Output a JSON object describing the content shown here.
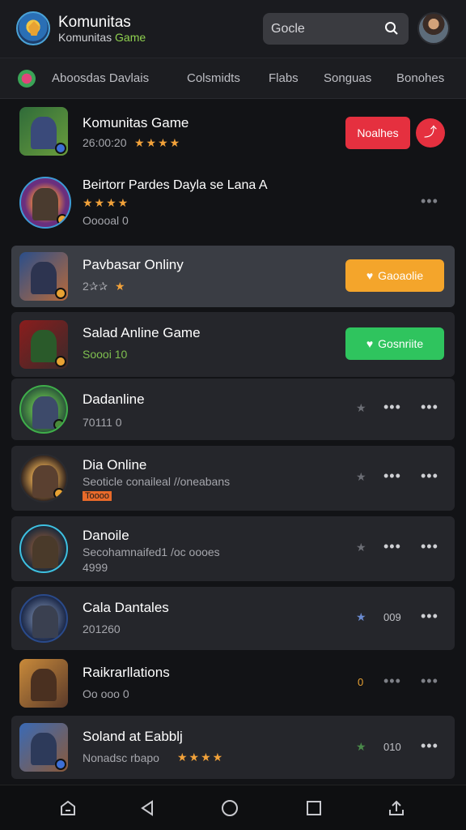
{
  "header": {
    "title": "Komunitas",
    "subtitle": "Komunitas",
    "subtitle_accent": "Game",
    "search_placeholder": "Gocle"
  },
  "tabs": [
    "Aboosdas Davlais",
    "Colsmidts",
    "Flabs",
    "Songuas",
    "Bonohes"
  ],
  "items": [
    {
      "title": "Komunitas Game",
      "sub": "26:00:20",
      "stars": "★★★★",
      "button": "Noalhes",
      "button_color": "#e5303f",
      "share_icon": "share-icon"
    },
    {
      "title": "Beirtorr Pardes Dayla se Lana A",
      "sub": "Ooooal 0",
      "stars": "★★★★"
    },
    {
      "title": "Pavbasar Onliny",
      "sub": "2✰✰",
      "stars": "★",
      "button": "Gaoaolie",
      "button_color": "#f4a52b"
    },
    {
      "title": "Salad Anline Game",
      "sub": "Soooi 10",
      "button": "Gosnriite",
      "button_color": "#2fc45e"
    },
    {
      "title": "Dadanline",
      "sub": "70111 0"
    },
    {
      "title": "Dia Online",
      "sub": "Seoticle conaileal //oneabans",
      "tag": "Toooo"
    },
    {
      "title": "Danoile",
      "sub": "Secohamnaifed1 /oc oooes",
      "sub2": "4999"
    },
    {
      "title": "Cala Dantales",
      "sub": "201260",
      "meta": "009"
    },
    {
      "title": "Raikrarllations",
      "sub": "Oo ooo 0",
      "meta": "0"
    },
    {
      "title": "Soland at Eabblj",
      "sub": "Nonadsc rbapo",
      "stars": "★★★★",
      "meta": "010"
    }
  ],
  "colors": {
    "background": "#121316",
    "card": "#25262b",
    "highlight": "#3a3d44",
    "accent_red": "#e5303f",
    "accent_orange": "#f4a52b",
    "accent_green": "#2fc45e",
    "star": "#f2a23a"
  }
}
